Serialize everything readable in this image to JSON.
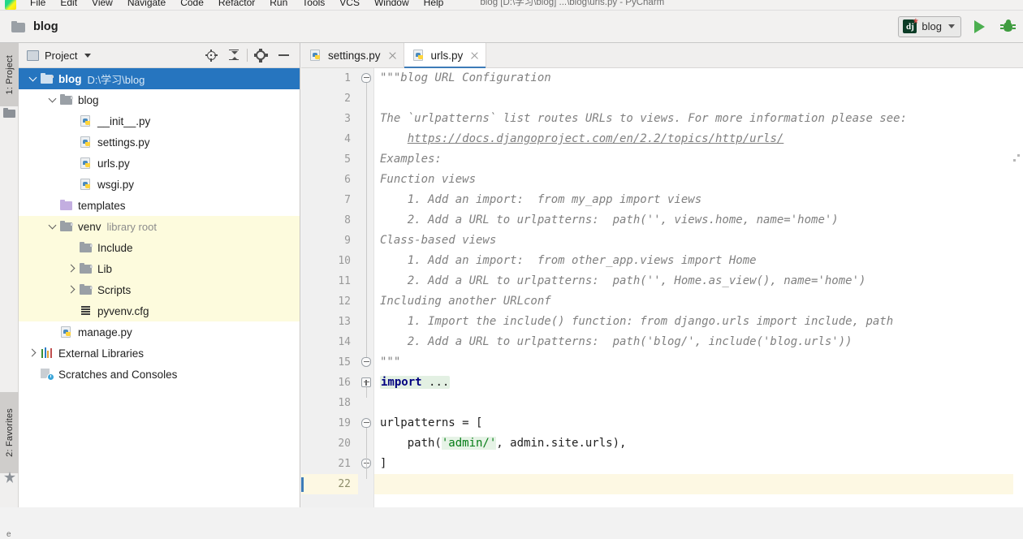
{
  "menubar": {
    "items": [
      "File",
      "Edit",
      "View",
      "Navigate",
      "Code",
      "Refactor",
      "Run",
      "Tools",
      "VCS",
      "Window",
      "Help"
    ],
    "window_title": "blog [D:\\学习\\blog] ...\\blog\\urls.py - PyCharm"
  },
  "toolbar": {
    "breadcrumb": "blog",
    "run_config_label": "blog",
    "run_button": "Run",
    "debug_button": "Debug"
  },
  "left_strip": {
    "project_tab": "1: Project",
    "favorites_tab": "2: Favorites"
  },
  "project_panel": {
    "title": "Project",
    "tools": [
      "locate-icon",
      "collapse-all-icon",
      "settings-icon",
      "hide-icon"
    ],
    "tree": [
      {
        "indent": 0,
        "chev": "down",
        "icon": "folder-icon",
        "label": "blog",
        "suffix": "D:\\学习\\blog",
        "bold": true,
        "selected": true,
        "venv": false
      },
      {
        "indent": 1,
        "chev": "down",
        "icon": "folder-icon",
        "label": "blog",
        "suffix": "",
        "bold": false,
        "selected": false,
        "venv": false
      },
      {
        "indent": 2,
        "chev": "blank",
        "icon": "python-file-icon",
        "label": "__init__.py",
        "suffix": "",
        "bold": false,
        "selected": false,
        "venv": false
      },
      {
        "indent": 2,
        "chev": "blank",
        "icon": "python-file-icon",
        "label": "settings.py",
        "suffix": "",
        "bold": false,
        "selected": false,
        "venv": false
      },
      {
        "indent": 2,
        "chev": "blank",
        "icon": "python-file-icon",
        "label": "urls.py",
        "suffix": "",
        "bold": false,
        "selected": false,
        "venv": false
      },
      {
        "indent": 2,
        "chev": "blank",
        "icon": "python-file-icon",
        "label": "wsgi.py",
        "suffix": "",
        "bold": false,
        "selected": false,
        "venv": false
      },
      {
        "indent": 1,
        "chev": "blank",
        "icon": "folder-purple-icon",
        "label": "templates",
        "suffix": "",
        "bold": false,
        "selected": false,
        "venv": false
      },
      {
        "indent": 1,
        "chev": "down",
        "icon": "folder-icon",
        "label": "venv",
        "suffix": "library root",
        "bold": false,
        "selected": false,
        "venv": true
      },
      {
        "indent": 2,
        "chev": "blank",
        "icon": "folder-icon",
        "label": "Include",
        "suffix": "",
        "bold": false,
        "selected": false,
        "venv": true
      },
      {
        "indent": 2,
        "chev": "right",
        "icon": "folder-icon",
        "label": "Lib",
        "suffix": "",
        "bold": false,
        "selected": false,
        "venv": true
      },
      {
        "indent": 2,
        "chev": "right",
        "icon": "folder-icon",
        "label": "Scripts",
        "suffix": "",
        "bold": false,
        "selected": false,
        "venv": true
      },
      {
        "indent": 2,
        "chev": "blank",
        "icon": "config-file-icon",
        "label": "pyvenv.cfg",
        "suffix": "",
        "bold": false,
        "selected": false,
        "venv": true
      },
      {
        "indent": 1,
        "chev": "blank",
        "icon": "python-file-icon",
        "label": "manage.py",
        "suffix": "",
        "bold": false,
        "selected": false,
        "venv": false
      },
      {
        "indent": 0,
        "chev": "right",
        "icon": "libraries-icon",
        "label": "External Libraries",
        "suffix": "",
        "bold": false,
        "selected": false,
        "venv": false
      },
      {
        "indent": 0,
        "chev": "blank",
        "icon": "scratches-icon",
        "label": "Scratches and Consoles",
        "suffix": "",
        "bold": false,
        "selected": false,
        "venv": false
      }
    ]
  },
  "editor": {
    "tabs": [
      {
        "label": "settings.py",
        "active": false,
        "icon": "python-file-icon"
      },
      {
        "label": "urls.py",
        "active": true,
        "icon": "python-file-icon"
      }
    ],
    "current_line": 22,
    "lines": [
      {
        "num": "1",
        "text": "\"\"\"blog URL Configuration",
        "style": "doc",
        "fold": "round-minus"
      },
      {
        "num": "2",
        "text": "",
        "style": "doc",
        "fold": ""
      },
      {
        "num": "3",
        "text": "The `urlpatterns` list routes URLs to views. For more information please see:",
        "style": "doc",
        "fold": ""
      },
      {
        "num": "4",
        "text": "    https://docs.djangoproject.com/en/2.2/topics/http/urls/",
        "style": "link",
        "fold": ""
      },
      {
        "num": "5",
        "text": "Examples:",
        "style": "doc",
        "fold": ""
      },
      {
        "num": "6",
        "text": "Function views",
        "style": "doc",
        "fold": ""
      },
      {
        "num": "7",
        "text": "    1. Add an import:  from my_app import views",
        "style": "doc",
        "fold": ""
      },
      {
        "num": "8",
        "text": "    2. Add a URL to urlpatterns:  path('', views.home, name='home')",
        "style": "doc",
        "fold": ""
      },
      {
        "num": "9",
        "text": "Class-based views",
        "style": "doc",
        "fold": ""
      },
      {
        "num": "10",
        "text": "    1. Add an import:  from other_app.views import Home",
        "style": "doc",
        "fold": ""
      },
      {
        "num": "11",
        "text": "    2. Add a URL to urlpatterns:  path('', Home.as_view(), name='home')",
        "style": "doc",
        "fold": ""
      },
      {
        "num": "12",
        "text": "Including another URLconf",
        "style": "doc",
        "fold": ""
      },
      {
        "num": "13",
        "text": "    1. Import the include() function: from django.urls import include, path",
        "style": "doc",
        "fold": ""
      },
      {
        "num": "14",
        "text": "    2. Add a URL to urlpatterns:  path('blog/', include('blog.urls'))",
        "style": "doc",
        "fold": ""
      },
      {
        "num": "15",
        "text": "\"\"\"",
        "style": "doc",
        "fold": "round-end"
      },
      {
        "num": "16",
        "text": "import ...",
        "style": "folded-import",
        "fold": "square-plus"
      },
      {
        "num": "18",
        "text": "",
        "style": "plain",
        "fold": ""
      },
      {
        "num": "19",
        "text": "urlpatterns = [",
        "style": "plain",
        "fold": "round-minus"
      },
      {
        "num": "20",
        "text": "    path('admin/', admin.site.urls),",
        "style": "code-str",
        "fold": ""
      },
      {
        "num": "21",
        "text": "]",
        "style": "plain",
        "fold": "round-end"
      },
      {
        "num": "22",
        "text": "",
        "style": "plain",
        "fold": ""
      }
    ]
  },
  "colors": {
    "accent_blue": "#2675bf",
    "tab_underline": "#3c7bb8",
    "venv_bg": "#fdfbdd",
    "current_line_bg": "#fdf8e3",
    "docstring": "#808080",
    "keyword": "#000080",
    "string": "#067d17",
    "run_green": "#4caf50"
  }
}
